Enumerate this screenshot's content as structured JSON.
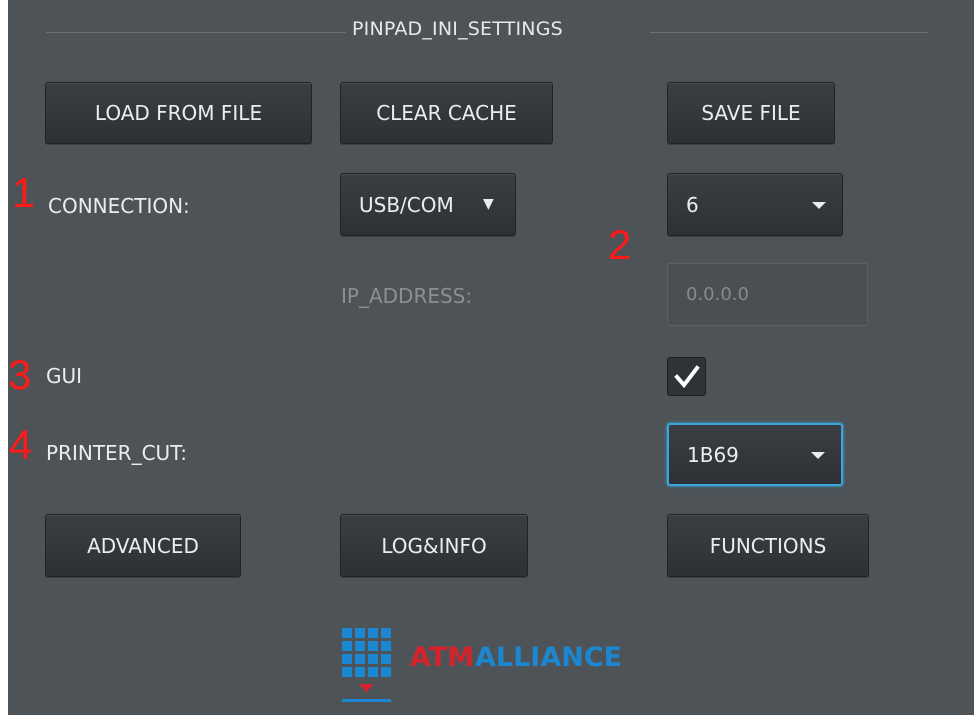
{
  "group": {
    "title": "PINPAD_INI_SETTINGS"
  },
  "toolbar": {
    "load_label": "LOAD FROM FILE",
    "clear_label": "CLEAR CACHE",
    "save_label": "SAVE FILE"
  },
  "markers": [
    "1",
    "2",
    "3",
    "4"
  ],
  "connection": {
    "label": "CONNECTION:",
    "type_value": "USB/COM",
    "port_value": "6"
  },
  "ip": {
    "label": "IP_ADDRESS:",
    "value": "0.0.0.0"
  },
  "gui": {
    "label": "GUI",
    "checked": true
  },
  "printer_cut": {
    "label": "PRINTER_CUT:",
    "value": "1B69"
  },
  "bottom_buttons": {
    "advanced_label": "ADVANCED",
    "loginfo_label": "LOG&INFO",
    "functions_label": "FUNCTIONS"
  },
  "logo": {
    "word1": "ATM",
    "word2": "ALLIANCE",
    "colors": {
      "red": "#d6232b",
      "blue": "#1c86d1"
    }
  },
  "icons": [
    "dropdown-arrow-icon",
    "checkmark-icon",
    "atm-alliance-logo-icon"
  ]
}
